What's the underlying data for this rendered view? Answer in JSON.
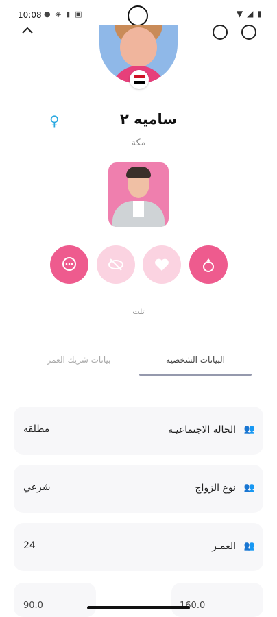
{
  "status_bar": {
    "time": "10:08",
    "left_icons": [
      "chat-icon",
      "shield-icon",
      "lock-icon",
      "sim-icon"
    ],
    "right_icons": [
      "wifi-icon",
      "signal-icon",
      "battery-icon"
    ]
  },
  "profile": {
    "name": "ساميه ٢",
    "city": "مكة",
    "gender_icon": "♀",
    "flag_colors": [
      "#ce1126",
      "#ffffff",
      "#000000"
    ]
  },
  "actions": {
    "small_label": "تلت",
    "buttons": [
      {
        "name": "chat",
        "color": "#ee5b8e"
      },
      {
        "name": "hide",
        "color": "#fbd3e1"
      },
      {
        "name": "like",
        "color": "#fbd3e1"
      },
      {
        "name": "ring",
        "color": "#ee5b8e"
      }
    ]
  },
  "tabs": {
    "personal": "البيانات الشخصيه",
    "partner": "بيانات شريك العمر"
  },
  "info_rows": [
    {
      "label": "الحالة الاجتماعيـة",
      "value": "مطلقه"
    },
    {
      "label": "نوع الزواج",
      "value": "شرعي"
    },
    {
      "label": "العمـر",
      "value": "24"
    }
  ],
  "partial_row": {
    "right_value": "160.0",
    "left_value": "90.0"
  },
  "colors": {
    "accent": "#ee5b8e",
    "accent_light": "#fbd3e1",
    "gender": "#29a8e0",
    "tab_underline": "#9599ad"
  }
}
